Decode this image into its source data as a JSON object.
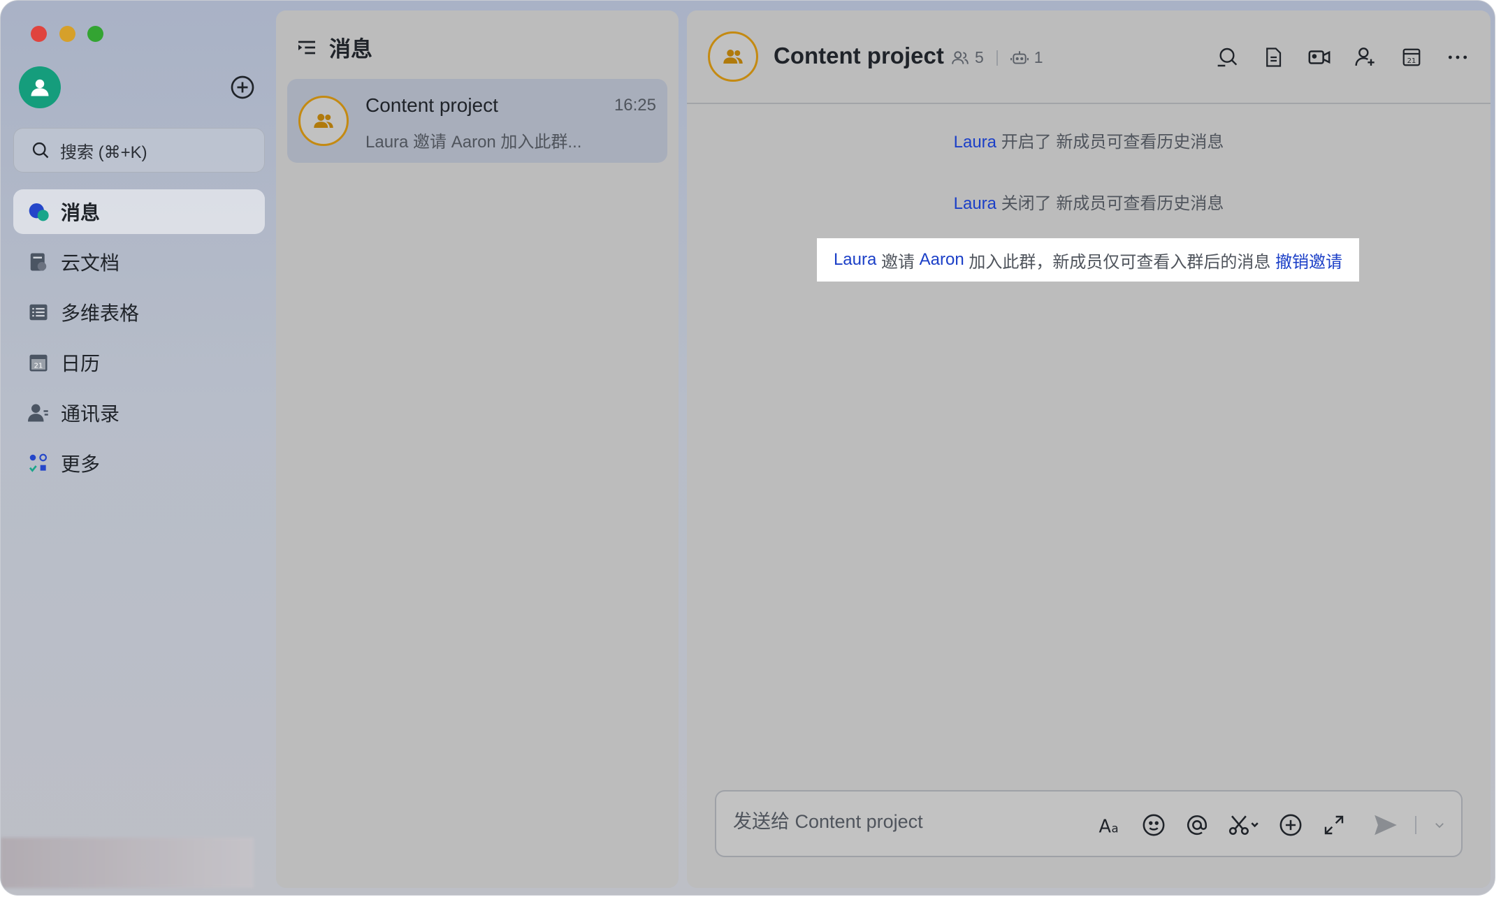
{
  "sidebar": {
    "search_placeholder": "搜索 (⌘+K)",
    "items": [
      {
        "label": "消息",
        "icon": "messages-icon",
        "active": true
      },
      {
        "label": "云文档",
        "icon": "cloud-docs-icon"
      },
      {
        "label": "多维表格",
        "icon": "base-table-icon"
      },
      {
        "label": "日历",
        "icon": "calendar-icon"
      },
      {
        "label": "通讯录",
        "icon": "contacts-icon"
      },
      {
        "label": "更多",
        "icon": "more-apps-icon"
      }
    ]
  },
  "conversations": {
    "header": "消息",
    "items": [
      {
        "title": "Content project",
        "time": "16:25",
        "preview": "Laura 邀请 Aaron 加入此群..."
      }
    ]
  },
  "chat": {
    "title": "Content project",
    "member_count": "5",
    "bot_count": "1",
    "messages": [
      {
        "actor": "Laura",
        "text": "开启了 新成员可查看历史消息"
      },
      {
        "actor": "Laura",
        "text": "关闭了 新成员可查看历史消息"
      }
    ],
    "invite": {
      "actor": "Laura",
      "verb": "邀请",
      "target": "Aaron",
      "text": "加入此群，新成员仅可查看入群后的消息",
      "action": "撤销邀请"
    },
    "composer_placeholder": "发送给 Content project"
  },
  "colors": {
    "link": "#1b3fc7",
    "avatar_green": "#159d7c",
    "group_avatar_ring": "#c48a12"
  }
}
